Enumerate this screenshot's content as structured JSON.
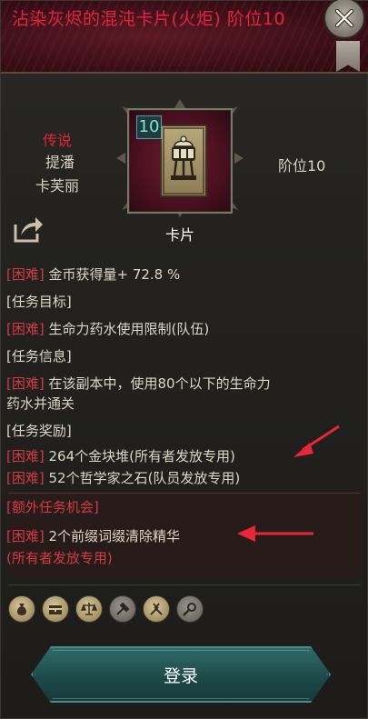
{
  "header": {
    "title": "沾染灰烬的混沌卡片(火炬) 阶位10"
  },
  "info": {
    "tier": "传说",
    "name_line1": "提潘",
    "name_line2": "卡芙丽",
    "rank": "阶位10",
    "card_level": "10",
    "card_caption": "卡片"
  },
  "tasks": {
    "row_gold": {
      "tag": "[困难]",
      "text": " 金币获得量+ 72.8 %"
    },
    "head_goal": "[任务目标]",
    "row_goal": {
      "tag": "[困难]",
      "text": " 生命力药水使用限制(队伍)"
    },
    "head_info": "[任务信息]",
    "row_info_1": {
      "tag": "[困难]",
      "text": " 在该副本中，使用80个以下的生命力"
    },
    "row_info_2": "药水并通关",
    "head_reward": "[任务奖励]",
    "row_reward_1": {
      "tag": "[困难]",
      "text": " 264个金块堆(所有者发放专用)"
    },
    "row_reward_2": {
      "tag": "[困难]",
      "text": " 52个哲学家之石(队员发放专用)"
    }
  },
  "extra": {
    "head": "[额外任务机会]",
    "row": {
      "tag": "[困难]",
      "text": " 2个前缀词缀清除精华"
    },
    "row_cont": "(所有者发放专用)"
  },
  "bottom_icons": [
    "money-bag-icon",
    "chest-icon",
    "scales-icon",
    "hammer-icon",
    "pliers-icon",
    "gear-tool-icon"
  ],
  "login": {
    "label": "登录"
  },
  "colors": {
    "accent_red": "#e0253f",
    "teal": "#2f6b68",
    "text": "#ddd6c8"
  }
}
